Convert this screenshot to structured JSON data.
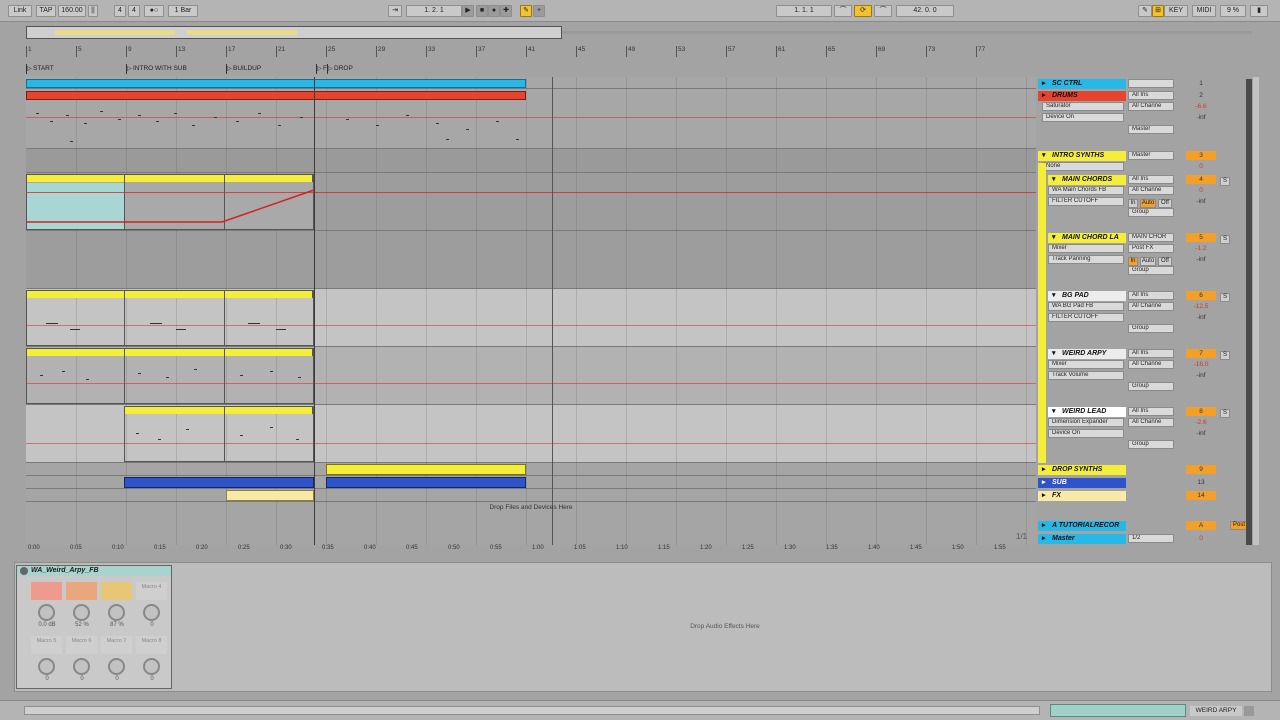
{
  "topbar": {
    "link": "Link",
    "tap": "TAP",
    "tempo": "160.00",
    "time_sig_num": "4",
    "time_sig_den": "4",
    "metro_quant": "1 Bar",
    "arr_pos_bar": "1",
    "arr_pos_beat": "2",
    "arr_pos_sixteenth": "1",
    "loop_start": "1. 1. 1",
    "loop_length": "42. 0. 0",
    "key": "KEY",
    "midi": "MIDI",
    "cpu": "9 %"
  },
  "ruler": {
    "bars": [
      "1",
      "5",
      "9",
      "13",
      "17",
      "21",
      "25",
      "29",
      "33",
      "37",
      "41",
      "45",
      "49",
      "53",
      "57",
      "61",
      "65",
      "69",
      "73",
      "77"
    ]
  },
  "locators": [
    {
      "label": "START"
    },
    {
      "label": "INTRO WITH SUB"
    },
    {
      "label": "BUILDUP"
    },
    {
      "label": "F"
    },
    {
      "label": "DROP"
    }
  ],
  "arrangement": {
    "drop_hint": "Drop Files and Devices Here",
    "page_indicator": "1/1"
  },
  "time_ruler": [
    "0:00",
    "0:05",
    "0:10",
    "0:15",
    "0:20",
    "0:25",
    "0:30",
    "0:35",
    "0:40",
    "0:45",
    "0:50",
    "0:55",
    "1:00",
    "1:05",
    "1:10",
    "1:15",
    "1:20",
    "1:25",
    "1:30",
    "1:35",
    "1:40",
    "1:45",
    "1:50",
    "1:55"
  ],
  "tracks": [
    {
      "name": "SC CTRL",
      "color": "#26b9e8",
      "num": "1",
      "input": "",
      "routing": ""
    },
    {
      "name": "DRUMS",
      "color": "#e8432f",
      "num": "2",
      "input": "All Ins",
      "channel": "All Channe",
      "device": "Saturator",
      "param": "Device On",
      "vol": "-6.6",
      "pan": "C",
      "vol2": "-inf",
      "out": "Master"
    },
    {
      "name": "INTRO SYNTHS",
      "color": "#f4ee3a",
      "num": "3",
      "input": "Master",
      "device": "None",
      "vol": "0"
    },
    {
      "name": "MAIN CHORDS",
      "color": "#f4ee3a",
      "num": "4",
      "input": "All Ins",
      "channel": "All Channe",
      "device": "WA Main Chords FB",
      "param": "FILTER CUTOFF",
      "vol": "0",
      "pan": "C",
      "vol2": "-inf",
      "out": "Group"
    },
    {
      "name": "MAIN CHORD LA",
      "color": "#f4ee3a",
      "num": "5",
      "input": "MAIN CHOR",
      "channel": "Post FX",
      "device": "Mixer",
      "param": "Track Panning",
      "vol": "-1.2",
      "pan": "C",
      "vol2": "-inf",
      "out": "Group"
    },
    {
      "name": "BG PAD",
      "color": "#f4ee3a",
      "num": "6",
      "input": "All Ins",
      "channel": "All Channe",
      "device": "WA BG Pad FB",
      "param": "FILTER CUTOFF",
      "vol": "-12.5",
      "pan": "C",
      "vol2": "-inf",
      "out": "Group"
    },
    {
      "name": "WEIRD ARPY",
      "color": "#f4ee3a",
      "num": "7",
      "input": "All Ins",
      "channel": "All Channe",
      "device": "Mixer",
      "param": "Track Volume",
      "vol": "-16.0",
      "pan": "C",
      "vol2": "-inf",
      "out": "Group"
    },
    {
      "name": "WEIRD LEAD",
      "color": "#f4ee3a",
      "num": "8",
      "input": "All Ins",
      "channel": "All Channe",
      "device": "Dimension Expander",
      "param": "Device On",
      "vol": "-2.6",
      "pan": "C",
      "vol2": "-inf",
      "out": "Group"
    },
    {
      "name": "DROP SYNTHS",
      "color": "#f4ee3a",
      "num": "9"
    },
    {
      "name": "SUB",
      "color": "#2f54c8",
      "num": "13"
    },
    {
      "name": "FX",
      "color": "#f9e9a6",
      "num": "14"
    },
    {
      "name": "A TUTORIALRECOR",
      "color": "#26b9e8",
      "num": "A",
      "extra": "Post"
    },
    {
      "name": "Master",
      "color": "#26b9e8",
      "num": "0",
      "input": "1/2"
    }
  ],
  "mixer_common": {
    "in": "In",
    "auto": "Auto",
    "off": "Off",
    "solo": "S"
  },
  "device": {
    "rack_name": "WA_Weird_Arpy_FB",
    "macros": [
      {
        "label": "",
        "value": "0.0 dB",
        "color": "#ee9a8f"
      },
      {
        "label": "",
        "value": "52 %",
        "color": "#e8a77d"
      },
      {
        "label": "",
        "value": "87 %",
        "color": "#e6c775"
      },
      {
        "label": "Macro 4",
        "value": "0",
        "color": "#cfcfcf"
      },
      {
        "label": "Macro 5",
        "value": "0",
        "color": "#cfcfcf"
      },
      {
        "label": "Macro 6",
        "value": "0",
        "color": "#cfcfcf"
      },
      {
        "label": "Macro 7",
        "value": "0",
        "color": "#cfcfcf"
      },
      {
        "label": "Macro 8",
        "value": "0",
        "color": "#cfcfcf"
      }
    ],
    "drop_hint": "Drop Audio Effects Here"
  },
  "bottombar": {
    "selected_track": "WEIRD ARPY"
  }
}
